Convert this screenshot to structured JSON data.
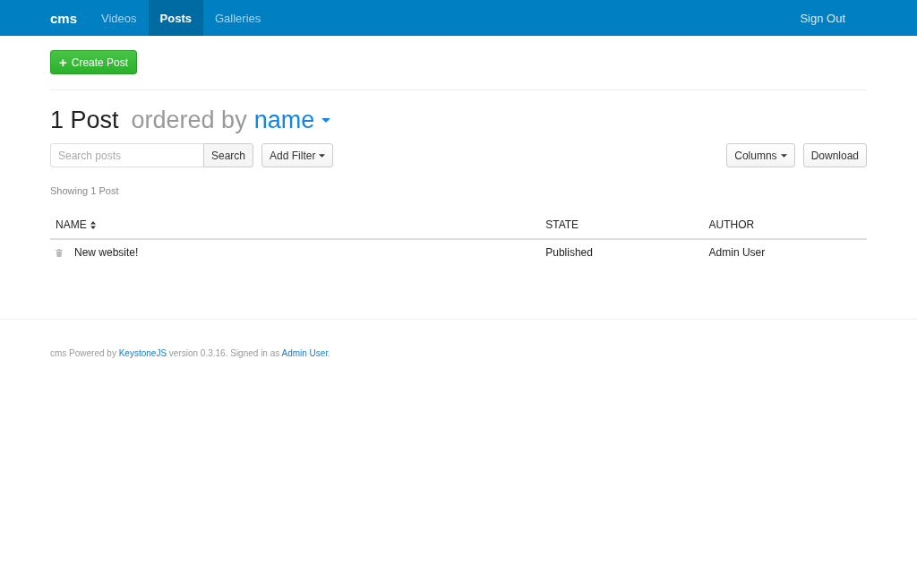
{
  "navbar": {
    "brand": "cms",
    "items": [
      {
        "label": "Videos",
        "selected": false
      },
      {
        "label": "Posts",
        "selected": true
      },
      {
        "label": "Galleries",
        "selected": false
      }
    ],
    "sign_out": "Sign Out"
  },
  "create_button": {
    "icon": "+",
    "label": "Create Post"
  },
  "heading": {
    "count": "1 Post",
    "ordered_by": "ordered by",
    "sort_field": "name"
  },
  "search": {
    "placeholder": "Search posts",
    "button": "Search"
  },
  "add_filter": "Add Filter",
  "columns_button": "Columns",
  "download_button": "Download",
  "showing": "Showing 1 Post",
  "table": {
    "columns": [
      {
        "label": "NAME",
        "sortable": true
      },
      {
        "label": "STATE",
        "sortable": false
      },
      {
        "label": "AUTHOR",
        "sortable": false
      }
    ],
    "rows": [
      {
        "cells": [
          "New website!",
          "Published",
          "Admin User"
        ]
      }
    ]
  },
  "footer": [
    {
      "kind": "text",
      "text": "cms Powered by "
    },
    {
      "kind": "link",
      "text": "KeystoneJS"
    },
    {
      "kind": "text",
      "text": " version 0.3.16. Signed in as "
    },
    {
      "kind": "link",
      "text": "Admin User"
    },
    {
      "kind": "text",
      "text": "."
    }
  ]
}
